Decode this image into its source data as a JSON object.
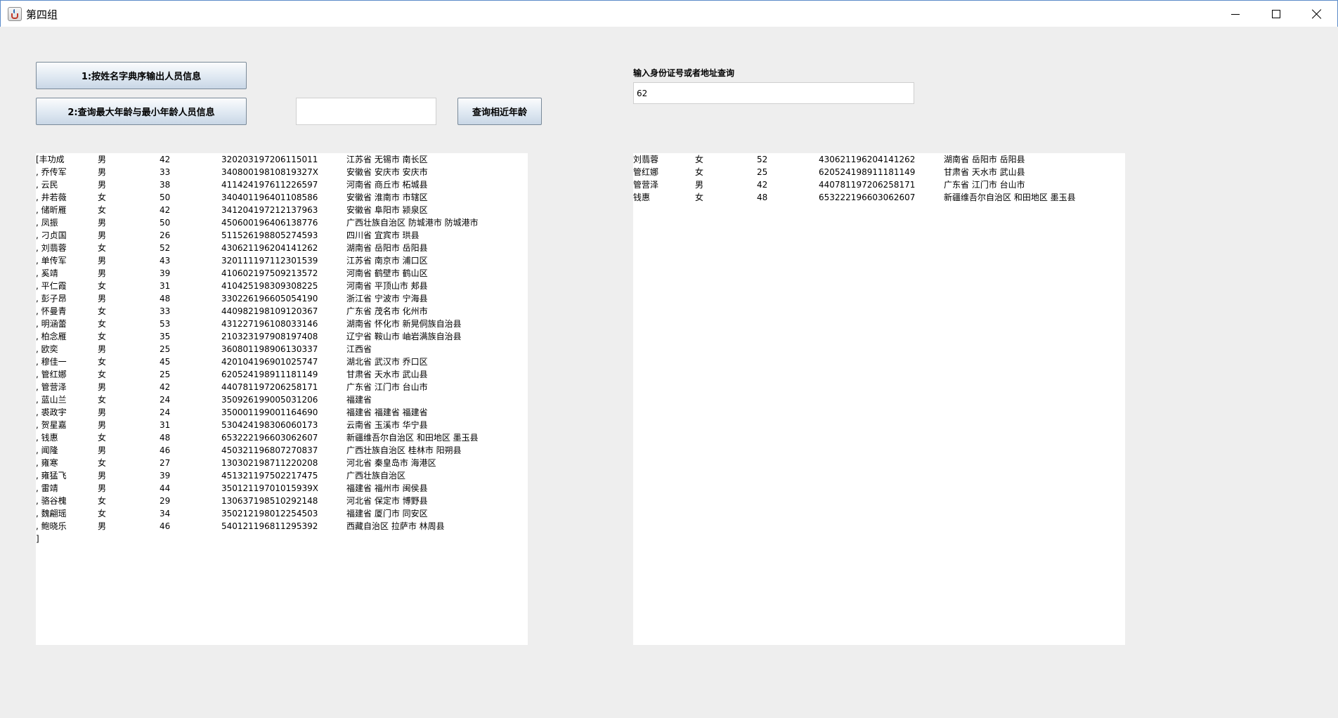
{
  "window": {
    "title": "第四组"
  },
  "buttons": {
    "sort_by_name": "1:按姓名字典序输出人员信息",
    "query_age_extremes": "2:查询最大年龄与最小年龄人员信息",
    "query_near_age": "查询相近年龄"
  },
  "age_input": {
    "value": ""
  },
  "query": {
    "label": "输入身份证号或者地址查询",
    "value": "62"
  },
  "left_list": {
    "rows": [
      [
        "[丰功成",
        "男",
        "42",
        "320203197206115011",
        "江苏省 无锡市 南长区"
      ],
      [
        ", 乔传军",
        "男",
        "33",
        "340800198108193​27X",
        "安徽省 安庆市 安庆市"
      ],
      [
        ", 云民",
        "男",
        "38",
        "411424197611226597",
        "河南省 商丘市 柘城县"
      ],
      [
        ", 井若薇",
        "女",
        "50",
        "340401196401108586",
        "安徽省 淮南市 市辖区"
      ],
      [
        ", 储昕雁",
        "女",
        "42",
        "341204197212137963",
        "安徽省 阜阳市 颍泉区"
      ],
      [
        ", 凤振",
        "男",
        "50",
        "450600196406138776",
        "广西壮族自治区 防城港市 防城港市"
      ],
      [
        ", 刁贞国",
        "男",
        "26",
        "511526198805274593",
        "四川省 宜宾市 珙县"
      ],
      [
        ", 刘翡蓉",
        "女",
        "52",
        "430621196204141262",
        "湖南省 岳阳市 岳阳县"
      ],
      [
        ", 单传军",
        "男",
        "43",
        "320111197112301539",
        "江苏省 南京市 浦口区"
      ],
      [
        ", 奚靖",
        "男",
        "39",
        "410602197509213572",
        "河南省 鹤壁市 鹤山区"
      ],
      [
        ", 平仁霞",
        "女",
        "31",
        "410425198309308225",
        "河南省 平顶山市 郏县"
      ],
      [
        ", 彭子昂",
        "男",
        "48",
        "330226196605054190",
        "浙江省 宁波市 宁海县"
      ],
      [
        ", 怀曼青",
        "女",
        "33",
        "440982198109120367",
        "广东省 茂名市 化州市"
      ],
      [
        ", 明涵蕾",
        "女",
        "53",
        "431227196108033146",
        "湖南省 怀化市 新晃侗族自治县"
      ],
      [
        ", 柏念雁",
        "女",
        "35",
        "210323197908197408",
        "辽宁省 鞍山市 岫岩满族自治县"
      ],
      [
        ", 欧奕",
        "男",
        "25",
        "360801198906130337",
        "江西省"
      ],
      [
        ", 穆佳一",
        "女",
        "45",
        "420104196901025747",
        "湖北省 武汉市 乔口区"
      ],
      [
        ", 管红娜",
        "女",
        "25",
        "620524198911181149",
        "甘肃省 天水市 武山县"
      ],
      [
        ", 管营泽",
        "男",
        "42",
        "440781197206258171",
        "广东省 江门市 台山市"
      ],
      [
        ", 蓝山兰",
        "女",
        "24",
        "350926199005031206",
        "福建省"
      ],
      [
        ", 裘政宇",
        "男",
        "24",
        "350001199001164690",
        "福建省 福建省 福建省"
      ],
      [
        ", 贺星嘉",
        "男",
        "31",
        "530424198306060173",
        "云南省 玉溪市 华宁县"
      ],
      [
        ", 钱惠",
        "女",
        "48",
        "653222196603062607",
        "新疆维吾尔自治区 和田地区 墨玉县"
      ],
      [
        ", 闻隆",
        "男",
        "46",
        "450321196807270837",
        "广西壮族自治区 桂林市 阳朔县"
      ],
      [
        ", 雍寒",
        "女",
        "27",
        "130302198711220208",
        "河北省 秦皇岛市 海港区"
      ],
      [
        ", 雍猛飞",
        "男",
        "39",
        "451321197502217475",
        "广西壮族自治区"
      ],
      [
        ", 雷靖",
        "男",
        "44",
        "350121197010159​39X",
        "福建省 福州市 闽侯县"
      ],
      [
        ", 骆谷槐",
        "女",
        "29",
        "130637198510292148",
        "河北省 保定市 博野县"
      ],
      [
        ", 魏翩瑶",
        "女",
        "34",
        "350212198012254503",
        "福建省 厦门市 同安区"
      ],
      [
        ", 鲍晓乐",
        "男",
        "46",
        "540121196811295392",
        "西藏自治区 拉萨市 林周县"
      ]
    ],
    "closing": "]"
  },
  "right_list": {
    "rows": [
      [
        "刘翡蓉",
        "女",
        "52",
        "430621196204141262",
        "湖南省 岳阳市 岳阳县"
      ],
      [
        "管红娜",
        "女",
        "25",
        "620524198911181149",
        "甘肃省 天水市 武山县"
      ],
      [
        "管营泽",
        "男",
        "42",
        "440781197206258171",
        "广东省 江门市 台山市"
      ],
      [
        "钱惠",
        "女",
        "48",
        "653222196603062607",
        "新疆维吾尔自治区 和田地区 墨玉县"
      ]
    ]
  },
  "icons": {
    "app": "java-cup-icon",
    "minimize": "minimize-icon",
    "maximize": "maximize-icon",
    "close": "close-icon"
  }
}
